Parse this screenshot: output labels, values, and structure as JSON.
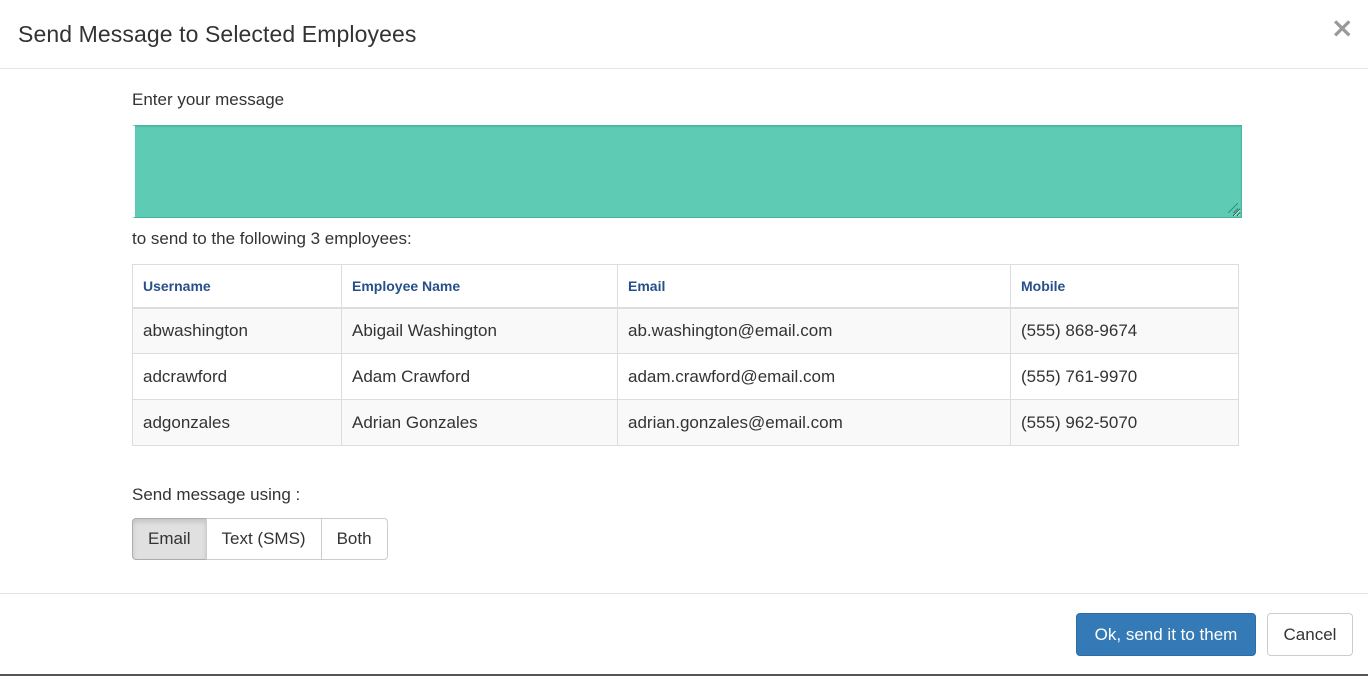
{
  "modal": {
    "title": "Send Message to Selected Employees",
    "close_glyph": "×",
    "close_icon": "close-icon"
  },
  "message": {
    "label": "Enter your message",
    "value": "",
    "textarea_color": "#5ecbb4"
  },
  "recipients": {
    "label": "to send to the following 3 employees:",
    "columns": [
      "Username",
      "Employee Name",
      "Email",
      "Mobile"
    ],
    "rows": [
      [
        "abwashington",
        "Abigail Washington",
        "ab.washington@email.com",
        "(555) 868-9674"
      ],
      [
        "adcrawford",
        "Adam Crawford",
        "adam.crawford@email.com",
        "(555) 761-9970"
      ],
      [
        "adgonzales",
        "Adrian Gonzales",
        "adrian.gonzales@email.com",
        "(555) 962-5070"
      ]
    ]
  },
  "send_using": {
    "label": "Send message using :",
    "options": [
      "Email",
      "Text (SMS)",
      "Both"
    ],
    "selected": "Email"
  },
  "footer": {
    "ok_label": "Ok, send it to them",
    "cancel_label": "Cancel",
    "primary_color": "#337ab7"
  }
}
